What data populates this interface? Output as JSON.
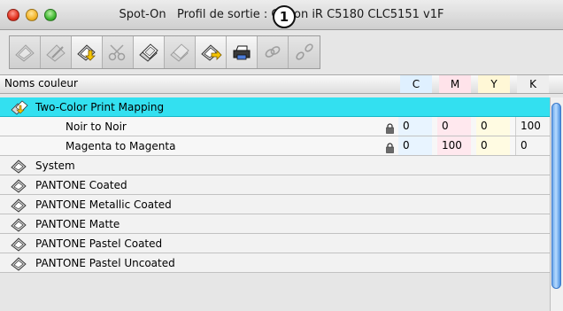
{
  "window": {
    "title": "Spot-On   Profil de sortie : C    on iR C5180 CLC5151 v1F",
    "callout": "1"
  },
  "toolbar": {
    "buttons": [
      {
        "icon": "swatchbook-icon",
        "enabled": false
      },
      {
        "icon": "swatchbook-edit-icon",
        "enabled": false
      },
      {
        "icon": "swatchbook-import-icon",
        "enabled": true
      },
      {
        "icon": "scissors-icon",
        "enabled": false
      },
      {
        "icon": "swatchbook-copy-icon",
        "enabled": true
      },
      {
        "icon": "swatchbook-paste-icon",
        "enabled": false
      },
      {
        "icon": "swatchbook-export-icon",
        "enabled": true
      },
      {
        "icon": "printer-icon",
        "enabled": true
      },
      {
        "icon": "link-icon",
        "enabled": false
      },
      {
        "icon": "unlink-icon",
        "enabled": false
      }
    ]
  },
  "columns": {
    "name": "Noms couleur",
    "c": "C",
    "m": "M",
    "y": "Y",
    "k": "K"
  },
  "rows": [
    {
      "label": "Two-Color Print Mapping",
      "type": "group",
      "selected": true,
      "icon": "two-color-mapping-icon"
    },
    {
      "label": "Noir to Noir",
      "type": "child",
      "c": "0",
      "m": "0",
      "y": "0",
      "k": "100"
    },
    {
      "label": "Magenta to Magenta",
      "type": "child",
      "c": "0",
      "m": "100",
      "y": "0",
      "k": "0"
    },
    {
      "label": "System",
      "type": "group",
      "icon": "swatchbook-icon"
    },
    {
      "label": "PANTONE Coated",
      "type": "group",
      "icon": "swatchbook-icon"
    },
    {
      "label": "PANTONE Metallic Coated",
      "type": "group",
      "icon": "swatchbook-icon"
    },
    {
      "label": "PANTONE Matte",
      "type": "group",
      "icon": "swatchbook-icon"
    },
    {
      "label": "PANTONE Pastel Coated",
      "type": "group",
      "icon": "swatchbook-icon"
    },
    {
      "label": "PANTONE Pastel Uncoated",
      "type": "group",
      "icon": "swatchbook-icon"
    }
  ],
  "colors": {
    "selection": "#33e0f0",
    "scrollbar": "#6aa6ea"
  }
}
